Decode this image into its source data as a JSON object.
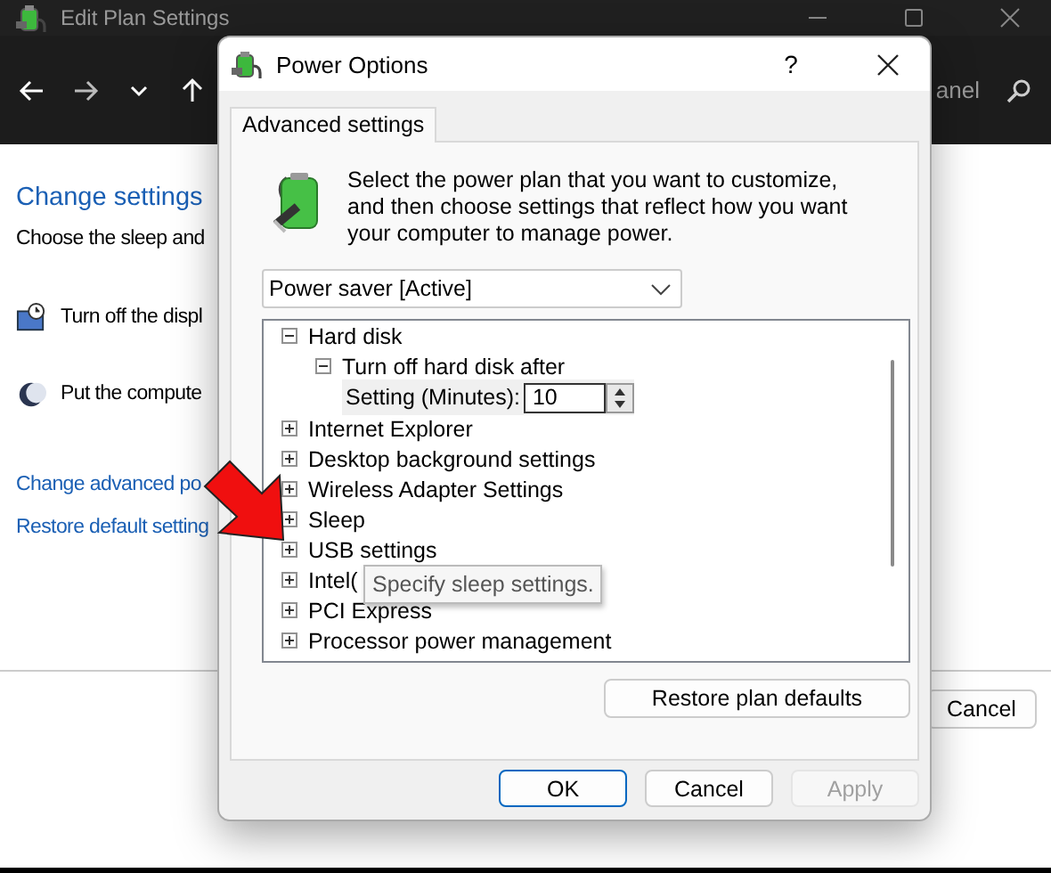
{
  "background_window": {
    "title": "Edit Plan Settings",
    "search": {
      "placeholder": "anel"
    },
    "heading": "Change settings",
    "description": "Choose the sleep and",
    "settings": [
      {
        "kind": "display",
        "label": "Turn off the displ"
      },
      {
        "kind": "sleep",
        "label": "Put the compute"
      }
    ],
    "links": [
      "Change advanced po",
      "Restore default setting"
    ],
    "buttons": [
      "Cancel"
    ]
  },
  "dialog": {
    "title": "Power Options",
    "help": "?",
    "tabs": [
      {
        "label": "Advanced settings",
        "selected": true
      }
    ],
    "intro": "Select the power plan that you want to customize, and then choose settings that reflect how you want your computer to manage power.",
    "plan_dropdown": {
      "value": "Power saver [Active]"
    },
    "tree": [
      {
        "kind": "group",
        "label": "Hard disk",
        "expanded": true,
        "children": [
          {
            "kind": "group",
            "label": "Turn off hard disk after",
            "expanded": true,
            "children": [
              {
                "kind": "setting",
                "label": "Setting (Minutes):",
                "value": "10"
              }
            ]
          }
        ]
      },
      {
        "kind": "group",
        "label": "Internet Explorer",
        "expanded": false
      },
      {
        "kind": "group",
        "label": "Desktop background settings",
        "expanded": false
      },
      {
        "kind": "group",
        "label": "Wireless Adapter Settings",
        "expanded": false
      },
      {
        "kind": "group",
        "label": "Sleep",
        "expanded": false
      },
      {
        "kind": "group",
        "label": "USB settings",
        "expanded": false
      },
      {
        "kind": "group",
        "label": "Intel(",
        "expanded": false
      },
      {
        "kind": "group",
        "label": "PCI Express",
        "expanded": false
      },
      {
        "kind": "group",
        "label": "Processor power management",
        "expanded": false
      }
    ],
    "restore_button": "Restore plan defaults",
    "buttons": [
      {
        "label": "OK",
        "default": true,
        "disabled": false
      },
      {
        "label": "Cancel",
        "default": false,
        "disabled": false
      },
      {
        "label": "Apply",
        "default": false,
        "disabled": true
      }
    ]
  },
  "tooltip": {
    "text": "Specify sleep settings."
  }
}
